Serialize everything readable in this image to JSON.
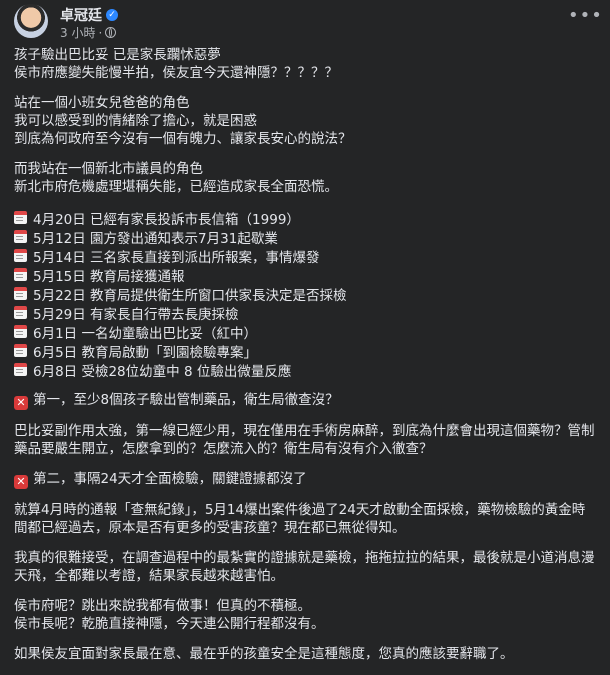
{
  "header": {
    "author": "卓冠廷",
    "timestamp": "3 小時",
    "more_icon": "more-horizontal-icon"
  },
  "post": {
    "intro": [
      "孩子驗出巴比妥 已是家長躝怵惡夢",
      "侯市府應變失能慢半拍，侯友宜今天還神隱？？？？？"
    ],
    "parent_role": [
      "站在一個小班女兒爸爸的角色",
      "我可以感受到的情緒除了擔心，就是困惑",
      "到底為何政府至今沒有一個有魄力、讓家長安心的說法？"
    ],
    "councilor_role": [
      "而我站在一個新北市議員的角色",
      "新北市府危機處理堪稱失能，已經造成家長全面恐慌。"
    ],
    "timeline": [
      "4月20日 已經有家長投訴市長信箱（1999）",
      "5月12日 園方發出通知表示7月31起歇業",
      "5月14日 三名家長直接到派出所報案，事情爆發",
      "5月15日 教育局接獲通報",
      "5月22日 教育局提供衛生所窗口供家長決定是否採檢",
      "5月29日 有家長自行帶去長庚採檢",
      "6月1日 一名幼童驗出巴比妥（紅中）",
      "6月5日 教育局啟動「到園檢驗專案」",
      "6月8日 受檢28位幼童中 8 位驗出微量反應"
    ],
    "point1_title": "第一，至少8個孩子驗出管制藥品，衛生局徹查沒？",
    "point1_body": [
      "巴比妥副作用太強，第一線已經少用，現在僅用在手術房麻醉，到底為什麼會出現這個藥物？管制",
      "藥品要嚴生開立，怎麼拿到的？怎麼流入的？衛生局有沒有介入徹查？"
    ],
    "point2_title": "第二，事隔24天才全面檢驗，關鍵證據都沒了",
    "point2_body": [
      "就算4月時的通報「查無紀錄」，5月14爆出案件後過了24天才啟動全面採檢，藥物檢驗的黃金時",
      "間都已經過去，原本是否有更多的受害孩童？現在都已無從得知。"
    ],
    "point2_extra": [
      "我真的很難接受，在調查過程中的最紮實的證據就是藥檢，拖拖拉拉的結果，最後就是小道消息漫",
      "天飛，全都難以考證，結果家長越來越害怕。"
    ],
    "questions": [
      "侯市府呢？跳出來說我都有做事！但真的不積極。",
      "侯市長呢？乾脆直接神隱，今天連公開行程都沒有。"
    ],
    "closing": "如果侯友宜面對家長最在意、最在乎的孩童安全是這種態度，您真的應該要辭職了。"
  }
}
